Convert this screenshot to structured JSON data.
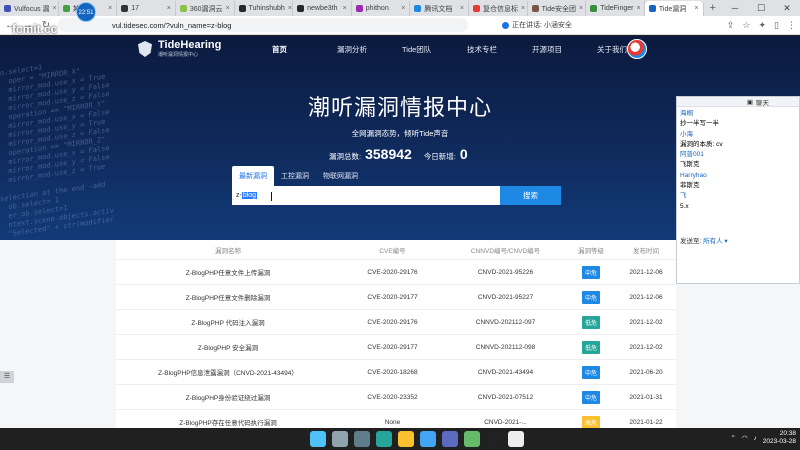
{
  "browser": {
    "tabs": [
      {
        "label": "Vulfocus 漏",
        "color": "#3f51b5"
      },
      {
        "label": "某",
        "color": "#43a047"
      },
      {
        "label": "17",
        "color": "#333333"
      },
      {
        "label": "360漏洞云",
        "color": "#8bc34a"
      },
      {
        "label": "Tuhinshubh",
        "color": "#24292e"
      },
      {
        "label": "newbe3th",
        "color": "#24292e"
      },
      {
        "label": "phithon",
        "color": "#9c27b0"
      },
      {
        "label": "腾讯文档",
        "color": "#1e88e5"
      },
      {
        "label": "复仓信息标",
        "color": "#e53935"
      },
      {
        "label": "Tide安全团",
        "color": "#795548"
      },
      {
        "label": "TideFinger",
        "color": "#388e3c"
      },
      {
        "label": "Tide漏洞",
        "color": "#1565c0"
      }
    ],
    "new_tab": "+",
    "url": "vul.tidesec.com/?vuln_name=z-blog",
    "speaking": "正在讲话: 小涵安全"
  },
  "watermark": {
    "circle": "22:51",
    "text": "fcmit.cc"
  },
  "site": {
    "logo_title": "TideHearing",
    "logo_sub": "潮听漏洞情报中心",
    "menu": [
      "首页",
      "漏洞分析",
      "Tide团队",
      "技术专栏",
      "开源项目",
      "关于我们"
    ],
    "hero_title": "潮听漏洞情报中心",
    "hero_sub": "全网漏洞态势，倾听Tide声音",
    "total_label": "漏洞总数:",
    "total_value": "358942",
    "today_label": "今日新增:",
    "today_value": "0",
    "search_tabs": [
      "最新漏洞",
      "工控漏洞",
      "物联网漏洞"
    ],
    "search_prefix": "z-",
    "search_selected": "blog",
    "search_button": "搜索"
  },
  "code_background": "o.select=1\n  oper = \"MIRROR_X\"\n  mirror_mod.use_x = True\n  mirror_mod.use_y = False\n  mirror_mod.use_z = False\n  operation == \"MIRROR_Y\"\n  mirror_mod.use_x = False\n  mirror_mod.use_y = True\n  mirror_mod.use_z = False\n  operation == \"MIRROR_Z\"\n  mirror_mod.use_x = False\n  mirror_mod.use_y = False\n  mirror_mod.use_z = True\n\nselection at the end -add\n  ob.select= 1\n  er_ob.select=1\n  ntext.scene.objects.activ\n  \"Selected\" + str(modifier",
  "table": {
    "headers": [
      "漏洞名称",
      "CVE编号",
      "CNNVD编号/CNVD编号",
      "漏洞等级",
      "发布时间"
    ],
    "rows": [
      {
        "name": "Z-BlogPHP任意文件上传漏洞",
        "cve": "CVE-2020-29176",
        "cnvd": "CNVD-2021-95226",
        "level": "中危",
        "color": "#1e88e5",
        "date": "2021-12-06"
      },
      {
        "name": "Z-BlogPHP任意文件删除漏洞",
        "cve": "CVE-2020-29177",
        "cnvd": "CNVD-2021-95227",
        "level": "中危",
        "color": "#1e88e5",
        "date": "2021-12-06"
      },
      {
        "name": "Z-BlogPHP 代码注入漏洞",
        "cve": "CVE-2020-29176",
        "cnvd": "CNNVD-202112-097",
        "level": "低危",
        "color": "#26a69a",
        "date": "2021-12-02"
      },
      {
        "name": "Z-BlogPHP 安全漏洞",
        "cve": "CVE-2020-29177",
        "cnvd": "CNNVD-202112-098",
        "level": "低危",
        "color": "#26a69a",
        "date": "2021-12-02"
      },
      {
        "name": "Z-BlogPHP信息泄露漏洞（CNVD-2021-43494）",
        "cve": "CVE-2020-18268",
        "cnvd": "CNVD-2021-43494",
        "level": "中危",
        "color": "#1e88e5",
        "date": "2021-06-20"
      },
      {
        "name": "Z-BlogPHP身份验证绕过漏洞",
        "cve": "CVE-2020-23352",
        "cnvd": "CNVD-2021-07512",
        "level": "中危",
        "color": "#1e88e5",
        "date": "2021-01-31"
      },
      {
        "name": "Z-BlogPHP存在任意代码执行漏洞",
        "cve": "None",
        "cnvd": "CNVD-2021-...",
        "level": "高危",
        "color": "#fbc02d",
        "date": "2021-01-22"
      }
    ]
  },
  "chat": {
    "title": "聊天",
    "messages": [
      {
        "text": "海桐",
        "nm": true
      },
      {
        "text": "抄一半写一半",
        "nm": false
      },
      {
        "text": "小海",
        "nm": true
      },
      {
        "text": "漏洞的本质: cv",
        "nm": false
      },
      {
        "text": "阿普001",
        "nm": true
      },
      {
        "text": "飞斯克",
        "nm": false
      },
      {
        "text": "Harryhao",
        "nm": true
      },
      {
        "text": "菲斯克",
        "nm": false
      },
      {
        "text": "飞",
        "nm": true
      },
      {
        "text": "5.x",
        "nm": false
      }
    ],
    "send_to_label": "发送至:",
    "send_to_value": "所有人 ▾"
  },
  "taskbar": {
    "time": "20:38",
    "date": "2023-03-28",
    "icons": [
      "start-icon",
      "search-icon",
      "taskview-icon",
      "edge-icon",
      "chrome-icon",
      "store-icon",
      "app-icon",
      "notepad-icon",
      "terminal-icon",
      "typora-icon"
    ],
    "icon_colors": [
      "#4fc3f7",
      "#90a4ae",
      "#607d8b",
      "#26a69a",
      "#fbc02d",
      "#42a5f5",
      "#5c6bc0",
      "#66bb6a",
      "#212121",
      "#eeeeee"
    ]
  }
}
